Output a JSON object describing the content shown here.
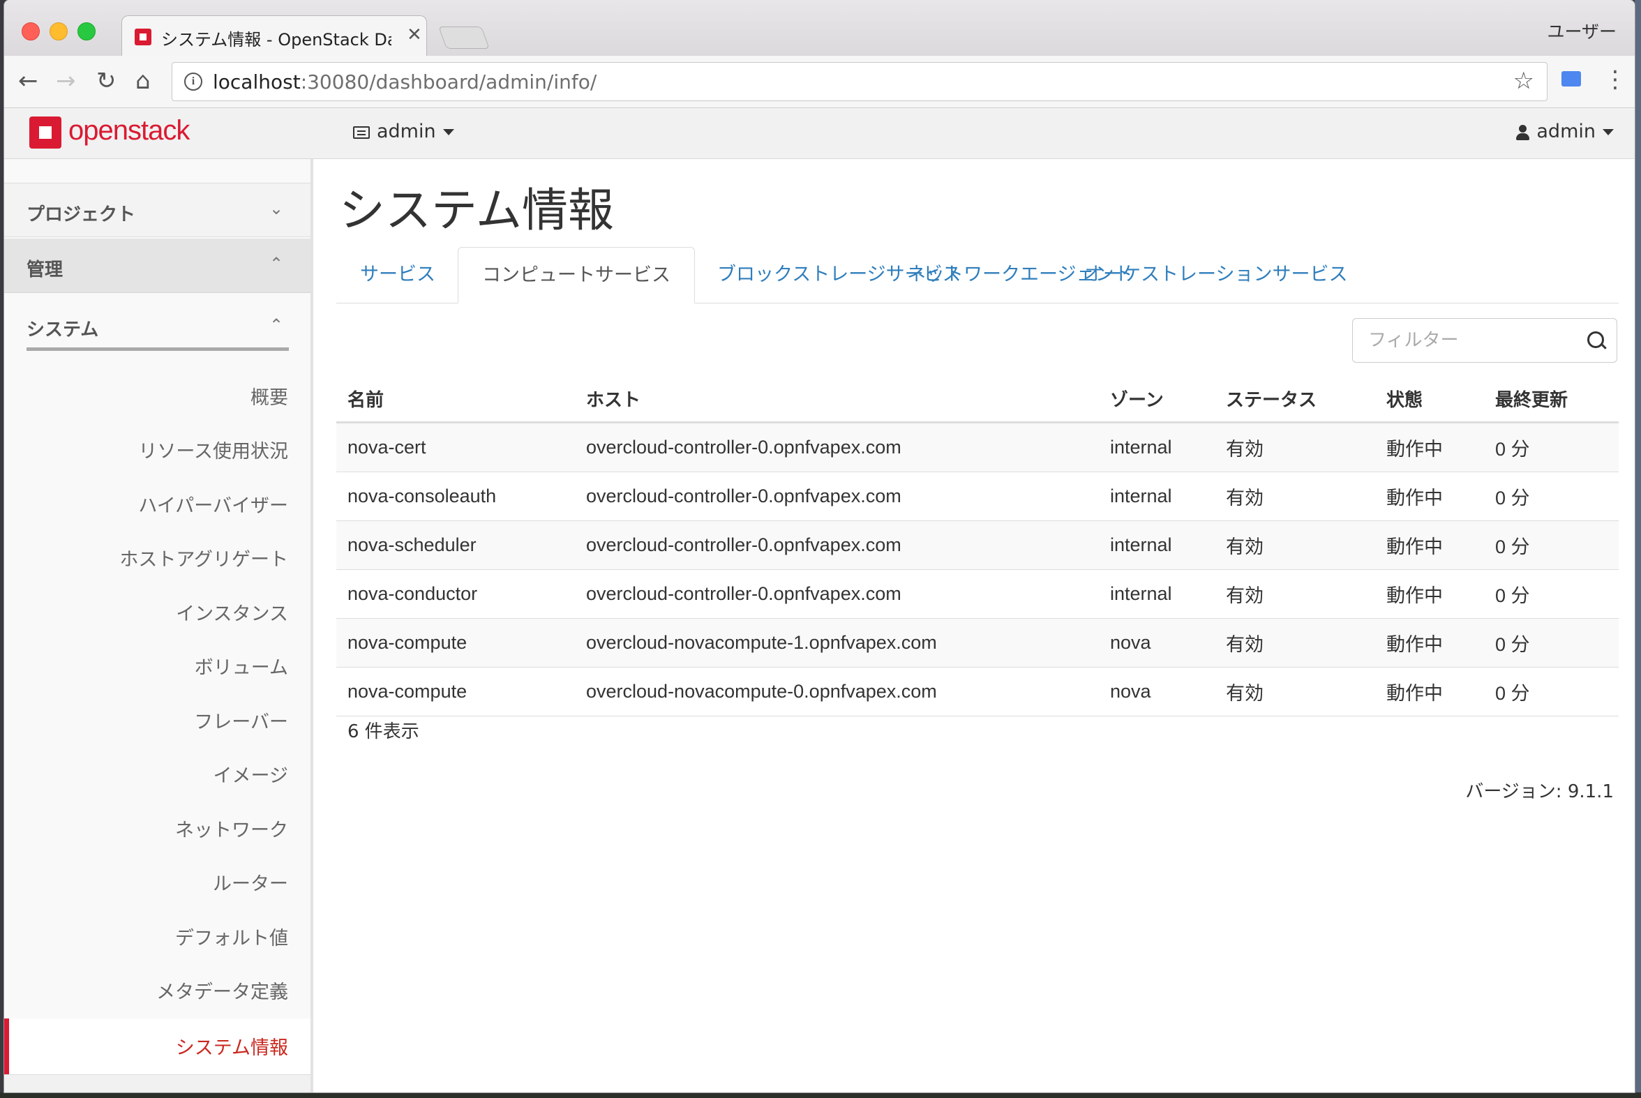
{
  "browser": {
    "tab_title": "システム情報 - OpenStack Dashboard",
    "user_label": "ユーザー",
    "url_host": "localhost",
    "url_rest": ":30080/dashboard/admin/info/"
  },
  "header": {
    "logo_text": "openstack",
    "project": "admin",
    "user": "admin"
  },
  "sidebar": {
    "sections": {
      "project": "プロジェクト",
      "admin": "管理",
      "system": "システム"
    },
    "items": [
      {
        "label": "概要"
      },
      {
        "label": "リソース使用状況"
      },
      {
        "label": "ハイパーバイザー"
      },
      {
        "label": "ホストアグリゲート"
      },
      {
        "label": "インスタンス"
      },
      {
        "label": "ボリューム"
      },
      {
        "label": "フレーバー"
      },
      {
        "label": "イメージ"
      },
      {
        "label": "ネットワーク"
      },
      {
        "label": "ルーター"
      },
      {
        "label": "デフォルト値"
      },
      {
        "label": "メタデータ定義"
      },
      {
        "label": "システム情報",
        "active": true
      }
    ]
  },
  "main": {
    "title": "システム情報",
    "tabs": [
      {
        "label": "サービス"
      },
      {
        "label": "コンピュートサービス",
        "active": true
      },
      {
        "label": "ブロックストレージサービス"
      },
      {
        "label": "ネットワークエージェント"
      },
      {
        "label": "オーケストレーションサービス"
      }
    ],
    "filter_placeholder": "フィルター",
    "columns": [
      "名前",
      "ホスト",
      "ゾーン",
      "ステータス",
      "状態",
      "最終更新"
    ],
    "rows": [
      [
        "nova-cert",
        "overcloud-controller-0.opnfvapex.com",
        "internal",
        "有効",
        "動作中",
        "0 分"
      ],
      [
        "nova-consoleauth",
        "overcloud-controller-0.opnfvapex.com",
        "internal",
        "有効",
        "動作中",
        "0 分"
      ],
      [
        "nova-scheduler",
        "overcloud-controller-0.opnfvapex.com",
        "internal",
        "有効",
        "動作中",
        "0 分"
      ],
      [
        "nova-conductor",
        "overcloud-controller-0.opnfvapex.com",
        "internal",
        "有効",
        "動作中",
        "0 分"
      ],
      [
        "nova-compute",
        "overcloud-novacompute-1.opnfvapex.com",
        "nova",
        "有効",
        "動作中",
        "0 分"
      ],
      [
        "nova-compute",
        "overcloud-novacompute-0.opnfvapex.com",
        "nova",
        "有効",
        "動作中",
        "0 分"
      ]
    ],
    "count_text": "6 件表示",
    "version_text": "バージョン: 9.1.1"
  },
  "colors": {
    "brand_red": "#da1a32",
    "link_blue": "#2f7ebc"
  }
}
